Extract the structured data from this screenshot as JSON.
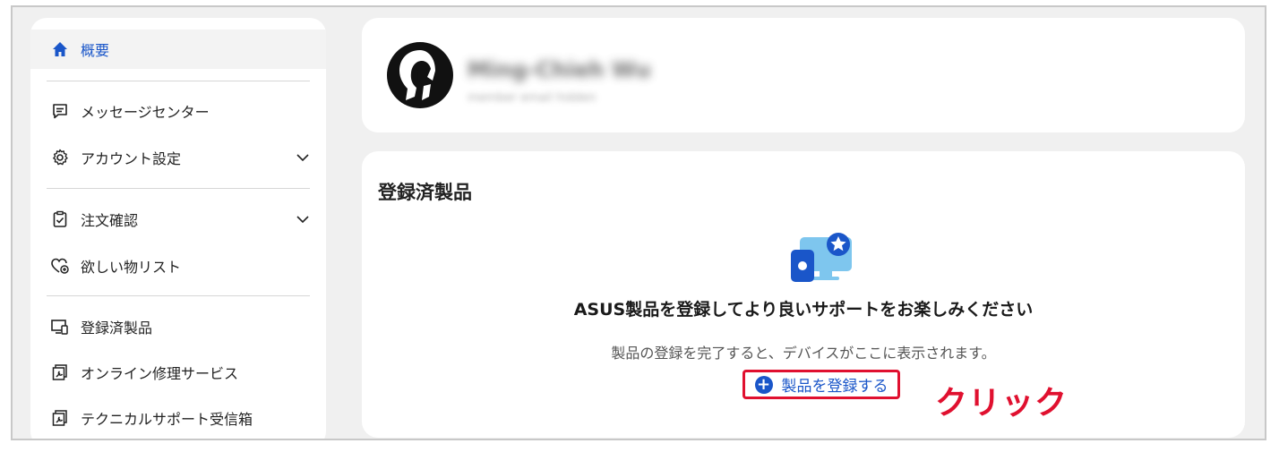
{
  "sidebar": {
    "items": [
      {
        "label": "概要",
        "icon": "home-icon"
      },
      {
        "label": "メッセージセンター",
        "icon": "message-icon"
      },
      {
        "label": "アカウント設定",
        "icon": "gear-icon"
      },
      {
        "label": "注文確認",
        "icon": "order-check-icon"
      },
      {
        "label": "欲しい物リスト",
        "icon": "heart-icon"
      },
      {
        "label": "登録済製品",
        "icon": "device-icon"
      },
      {
        "label": "オンライン修理サービス",
        "icon": "repair-icon"
      },
      {
        "label": "テクニカルサポート受信箱",
        "icon": "support-icon"
      }
    ]
  },
  "profile": {
    "name": "Ming-Chieh Wu",
    "email": "member email hidden"
  },
  "products": {
    "title": "登録済製品",
    "headline": "ASUS製品を登録してより良いサポートをお楽しみください",
    "subtext": "製品の登録を完了すると、デバイスがここに表示されます。",
    "register_label": "製品を登録する"
  },
  "annotation": {
    "text": "クリック",
    "color": "#e0102f"
  },
  "colors": {
    "accent": "#1a56c9",
    "highlight": "#e0102f",
    "background": "#f0f0f0"
  }
}
